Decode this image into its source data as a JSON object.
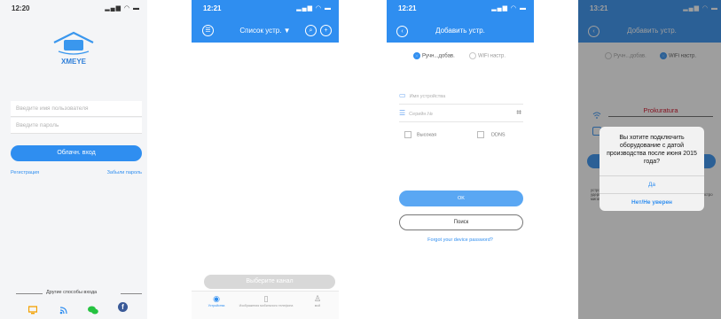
{
  "colors": {
    "accent": "#2f8ef0",
    "brand": "#3a97ee",
    "wechat": "#25c240",
    "facebook": "#3a5a98",
    "danger": "#d0021b"
  },
  "screen1": {
    "time": "12:20",
    "logo_text": "XMEYE",
    "username_placeholder": "Введите имя пользователя",
    "password_placeholder": "Введите пароль",
    "cloud_login_button": "Облачн. вход",
    "register_link": "Регистрация",
    "forgot_password_link": "Забыли пароль",
    "other_login_label": "Другие способы входа",
    "login_icons": [
      "device-icon",
      "wifi-icon",
      "wechat-icon",
      "facebook-icon"
    ]
  },
  "screen2": {
    "time": "12:21",
    "title": "Список устр. ▼",
    "select_channel_button": "Выберите канал",
    "tabs": [
      {
        "label": "Устройства",
        "icon": "camera-icon",
        "active": true
      },
      {
        "label": "Изображения мобильного телефона",
        "icon": "phone-icon",
        "active": false
      },
      {
        "label": "мой",
        "icon": "person-icon",
        "active": false
      }
    ]
  },
  "screen3": {
    "time": "12:21",
    "title": "Добавить устр.",
    "radio_manual": "Ручн...добав.",
    "radio_wifi": "WiFi настр.",
    "device_name_placeholder": "Имя устройства",
    "serial_placeholder": "Серийн.№",
    "checkbox_high": "Высокая",
    "checkbox_ddns": "DDNS",
    "ok_button": "OK",
    "search_button": "Поиск",
    "forgot_device_password_link": "Forgot your device password?"
  },
  "screen4": {
    "time": "13:21",
    "title": "Добавить устр.",
    "radio_manual": "Ручн...добав.",
    "radio_wifi": "WiFi настр.",
    "wifi_name": "Prokuratura",
    "dialog_message": "Вы хотите подключить оборудование с датой производства после июня 2015 года?",
    "dialog_yes": "Да",
    "dialog_no": "Нет/Не уверен",
    "instructions_text": "устройством, телефоном и маршрутизатором не превышает 3 м\nудерживайте кнопку SET до тех пор, пока индикатор не начнет быстро мигать!Part of pro..."
  }
}
